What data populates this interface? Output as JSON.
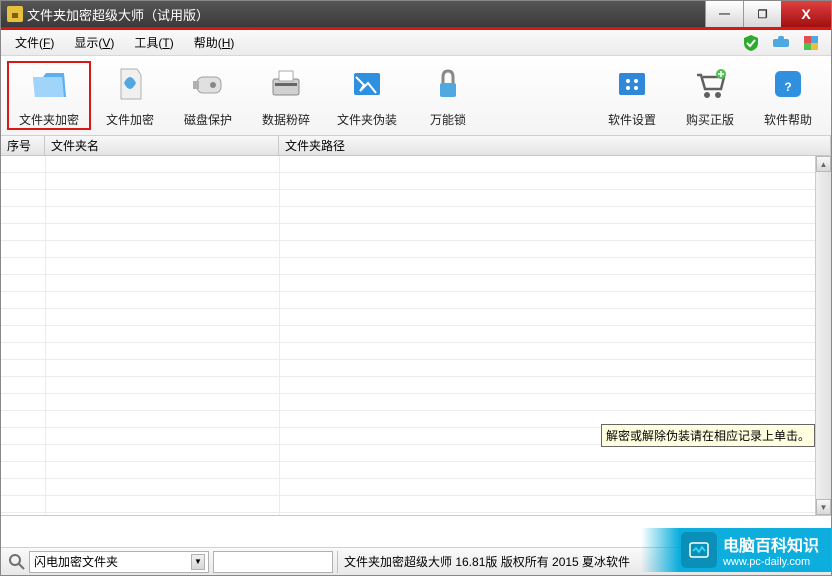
{
  "window": {
    "title": "文件夹加密超级大师（试用版）"
  },
  "menu": {
    "file": "文件(",
    "file_u": "F",
    "file_close": ")",
    "show": "显示(",
    "show_u": "V",
    "show_close": ")",
    "tool": "工具(",
    "tool_u": "T",
    "tool_close": ")",
    "help": "帮助(",
    "help_u": "H",
    "help_close": ")"
  },
  "toolbar": {
    "b1": "文件夹加密",
    "b2": "文件加密",
    "b3": "磁盘保护",
    "b4": "数据粉碎",
    "b5": "文件夹伪装",
    "b6": "万能锁",
    "b7": "软件设置",
    "b8": "购买正版",
    "b9": "软件帮助"
  },
  "columns": {
    "c1": "序号",
    "c2": "文件夹名",
    "c3": "文件夹路径"
  },
  "tooltip": "解密或解除伪装请在相应记录上单击。",
  "status": {
    "dropdown": "闪电加密文件夹",
    "copyright": "文件夹加密超级大师 16.81版 版权所有 2015 夏冰软件"
  },
  "watermark": {
    "cn": "电脑百科知识",
    "en": "www.pc-daily.com"
  }
}
